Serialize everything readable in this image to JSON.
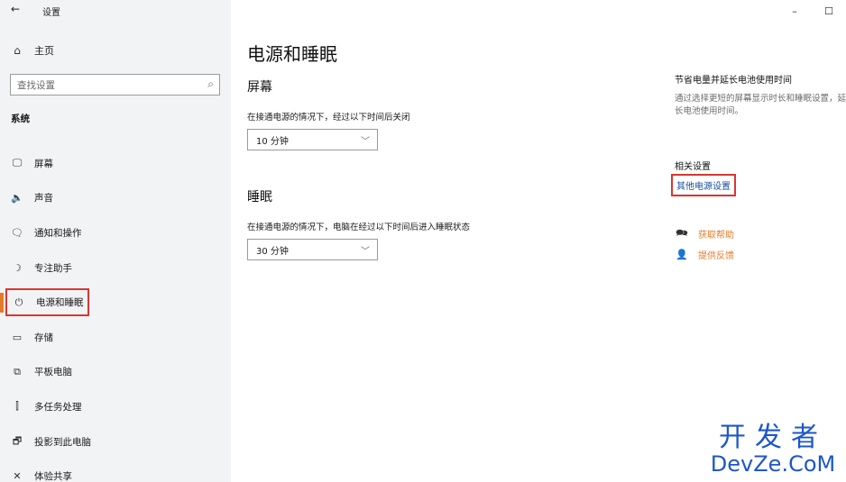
{
  "window": {
    "back_glyph": "←",
    "title": "设置",
    "minimize_glyph": "–",
    "maximize_glyph": "☐"
  },
  "sidebar": {
    "home_label": "主页",
    "search_placeholder": "查找设置",
    "section_label": "系统",
    "items": [
      {
        "label": "屏幕",
        "icon": "monitor-icon",
        "glyph": "🖵"
      },
      {
        "label": "声音",
        "icon": "speaker-icon",
        "glyph": "🔈"
      },
      {
        "label": "通知和操作",
        "icon": "notification-icon",
        "glyph": "🗨"
      },
      {
        "label": "专注助手",
        "icon": "moon-icon",
        "glyph": "☽"
      },
      {
        "label": "电源和睡眠",
        "icon": "power-icon",
        "glyph": "⏻",
        "selected": true
      },
      {
        "label": "存储",
        "icon": "storage-icon",
        "glyph": "▭"
      },
      {
        "label": "平板电脑",
        "icon": "tablet-icon",
        "glyph": "⧉"
      },
      {
        "label": "多任务处理",
        "icon": "multitask-icon",
        "glyph": "⫿"
      },
      {
        "label": "投影到此电脑",
        "icon": "project-icon",
        "glyph": "🗗"
      },
      {
        "label": "体验共享",
        "icon": "share-icon",
        "glyph": "✕"
      }
    ]
  },
  "main": {
    "title": "电源和睡眠",
    "screen": {
      "heading": "屏幕",
      "description": "在接通电源的情况下，经过以下时间后关闭",
      "value": "10 分钟"
    },
    "sleep": {
      "heading": "睡眠",
      "description": "在接通电源的情况下，电脑在经过以下时间后进入睡眠状态",
      "value": "30 分钟"
    }
  },
  "right": {
    "tip_title": "节省电量并延长电池使用时间",
    "tip_desc": "通过选择更短的屏幕显示时长和睡眠设置，延长电池使用时间。",
    "related_title": "相关设置",
    "related_link": "其他电源设置",
    "help_label": "获取帮助",
    "feedback_label": "提供反馈"
  },
  "watermark": {
    "cn": "开发者",
    "en": "DevZe.CoM"
  }
}
